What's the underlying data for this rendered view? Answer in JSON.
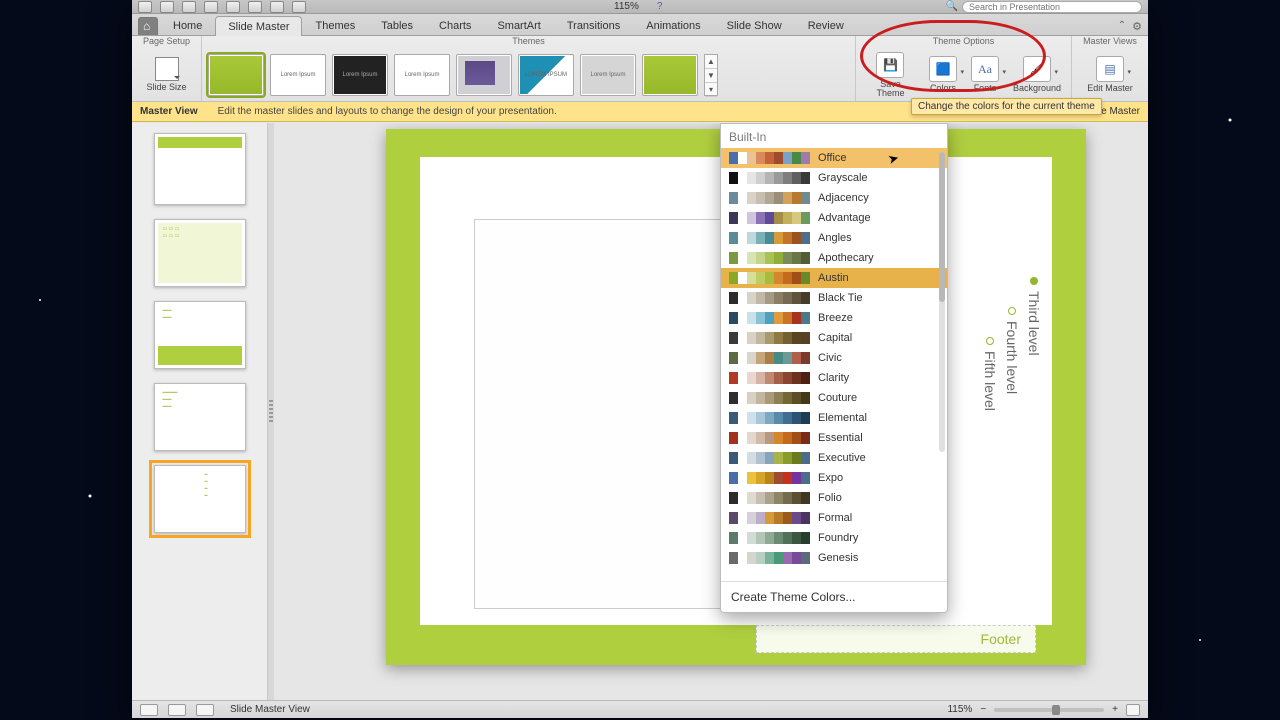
{
  "qat": {
    "zoom": "115%",
    "search_placeholder": "Search in Presentation",
    "help": "?"
  },
  "tabs": {
    "home": "Home",
    "list": [
      "Slide Master",
      "Themes",
      "Tables",
      "Charts",
      "SmartArt",
      "Transitions",
      "Animations",
      "Slide Show",
      "Review"
    ],
    "active": "Slide Master"
  },
  "ribbon": {
    "page_setup": {
      "title": "Page Setup",
      "slide_size": "Slide Size"
    },
    "themes": {
      "title": "Themes",
      "thumbs": [
        "",
        "Lorem Ipsum",
        "Lorem Ipsum",
        "Lorem Ipsum",
        "",
        "LOREM IPSUM",
        "Lorem Ipsum",
        ""
      ]
    },
    "theme_options": {
      "title": "Theme Options",
      "save": "Save Theme",
      "colors": "Colors",
      "fonts": "Fonts",
      "background": "Background"
    },
    "master_views": {
      "title": "Master Views",
      "edit_master": "Edit Master"
    },
    "tooltip": "Change the colors for the current theme"
  },
  "infobar": {
    "title": "Master View",
    "msg": "Edit the master slides and layouts to change the design of your presentation.",
    "close": "Close Master"
  },
  "canvas": {
    "date_ph": "‹#›",
    "levels": [
      "Third level",
      "Fourth level",
      "Fifth level"
    ],
    "footer": "Footer"
  },
  "colors_dropdown": {
    "header": "Built-In",
    "create": "Create Theme Colors...",
    "hover": "Office",
    "current": "Austin",
    "items": [
      {
        "name": "Office",
        "sw": [
          "#4a6ea9",
          "#fff",
          "#eac394",
          "#d9895a",
          "#c26437",
          "#9e4c2c",
          "#7aa2c9",
          "#478a45",
          "#a07aa8"
        ]
      },
      {
        "name": "Grayscale",
        "sw": [
          "#111",
          "#fff",
          "#e5e5e5",
          "#cfcfcf",
          "#b5b5b5",
          "#9a9a9a",
          "#7e7e7e",
          "#5f5f5f",
          "#3a3a3a"
        ]
      },
      {
        "name": "Adjacency",
        "sw": [
          "#6b8b9b",
          "#fff",
          "#d8d2c8",
          "#c6beb1",
          "#b1a793",
          "#9a8e76",
          "#d2a25a",
          "#b57a2f",
          "#6f8b8e"
        ]
      },
      {
        "name": "Advantage",
        "sw": [
          "#3c3758",
          "#fff",
          "#cfc6dd",
          "#8a74b4",
          "#5f4a97",
          "#a48e46",
          "#c4af5a",
          "#d7c87f",
          "#6b9a60"
        ]
      },
      {
        "name": "Angles",
        "sw": [
          "#5a8b98",
          "#fff",
          "#bfd8dc",
          "#7ab0b7",
          "#4a8a92",
          "#d79b39",
          "#c27428",
          "#9a5320",
          "#4c6e8a"
        ]
      },
      {
        "name": "Apothecary",
        "sw": [
          "#7a9940",
          "#fff",
          "#d9e3b4",
          "#c4d48a",
          "#a9c256",
          "#8fae3a",
          "#7a8a5a",
          "#6a7548",
          "#525c36"
        ]
      },
      {
        "name": "Austin",
        "sw": [
          "#8aa827",
          "#fff",
          "#d6df98",
          "#bfcd63",
          "#a9bb3a",
          "#d6862f",
          "#c46a1f",
          "#a04f17",
          "#6a8a2a"
        ]
      },
      {
        "name": "Black Tie",
        "sw": [
          "#2b2b2b",
          "#fff",
          "#d8d3c9",
          "#c1b9a8",
          "#a59a83",
          "#8b7e63",
          "#776a50",
          "#5f533c",
          "#463c29"
        ]
      },
      {
        "name": "Breeze",
        "sw": [
          "#2b4a62",
          "#fff",
          "#c8e2ea",
          "#8bc3d6",
          "#4fa0bb",
          "#e09b3d",
          "#c87428",
          "#a9321e",
          "#4a7a88"
        ]
      },
      {
        "name": "Capital",
        "sw": [
          "#3a3a3a",
          "#fff",
          "#d8d2c6",
          "#c2b89e",
          "#a9996e",
          "#8f7a44",
          "#746030",
          "#594620",
          "#584025"
        ]
      },
      {
        "name": "Civic",
        "sw": [
          "#5a6b45",
          "#fff",
          "#d9d4cc",
          "#c5a57a",
          "#a97f48",
          "#4a8a84",
          "#6b9a97",
          "#b0604a",
          "#7a3a2c"
        ]
      },
      {
        "name": "Clarity",
        "sw": [
          "#b03a24",
          "#fff",
          "#e8d6cf",
          "#d6b3a5",
          "#c08973",
          "#a56048",
          "#8a4530",
          "#6d3120",
          "#4e2015"
        ]
      },
      {
        "name": "Couture",
        "sw": [
          "#2e2e2e",
          "#fff",
          "#d8d0c2",
          "#c2b69e",
          "#a99a78",
          "#8f7f54",
          "#756638",
          "#5c4e25",
          "#443818"
        ]
      },
      {
        "name": "Elemental",
        "sw": [
          "#3a5a78",
          "#fff",
          "#cfe0ea",
          "#a7c6d8",
          "#7ea8c2",
          "#5a8aaa",
          "#3f6e90",
          "#2e5473",
          "#1f3c54"
        ]
      },
      {
        "name": "Essential",
        "sw": [
          "#a0321e",
          "#fff",
          "#e4d7d0",
          "#d0baaa",
          "#b99780",
          "#d6862f",
          "#c46a1f",
          "#a04f17",
          "#7a2a1a"
        ]
      },
      {
        "name": "Executive",
        "sw": [
          "#3a5a78",
          "#fff",
          "#d4dce2",
          "#b0c2d0",
          "#88a4bb",
          "#a9b34a",
          "#8a9a2c",
          "#6b7a1f",
          "#4a6e8a"
        ]
      },
      {
        "name": "Expo",
        "sw": [
          "#4a6ea9",
          "#fff",
          "#eac33a",
          "#d6a428",
          "#b6861c",
          "#a04a2f",
          "#c2321e",
          "#7433a0",
          "#4a6e8a"
        ]
      },
      {
        "name": "Folio",
        "sw": [
          "#2b2b2b",
          "#fff",
          "#dedad2",
          "#c7c0b2",
          "#aba28c",
          "#8e8468",
          "#746a4c",
          "#5a5035",
          "#413822"
        ]
      },
      {
        "name": "Formal",
        "sw": [
          "#5a4a6a",
          "#fff",
          "#d8cfdc",
          "#bcaec8",
          "#d69a3a",
          "#b87a28",
          "#9a5a1c",
          "#6b4a8a",
          "#4a3560"
        ]
      },
      {
        "name": "Foundry",
        "sw": [
          "#5a7a6a",
          "#fff",
          "#d2dcd4",
          "#b3c5b6",
          "#8fa993",
          "#6b8b72",
          "#507057",
          "#3a5540",
          "#283e2d"
        ]
      },
      {
        "name": "Genesis",
        "sw": [
          "#6a6a6a",
          "#fff",
          "#d8d3cc",
          "#b8cfc4",
          "#7ab39a",
          "#4a9a7a",
          "#9a6ab0",
          "#7a4a9a",
          "#5a6a7a"
        ]
      }
    ]
  },
  "status": {
    "view_label": "Slide Master View",
    "zoom": "115%"
  }
}
